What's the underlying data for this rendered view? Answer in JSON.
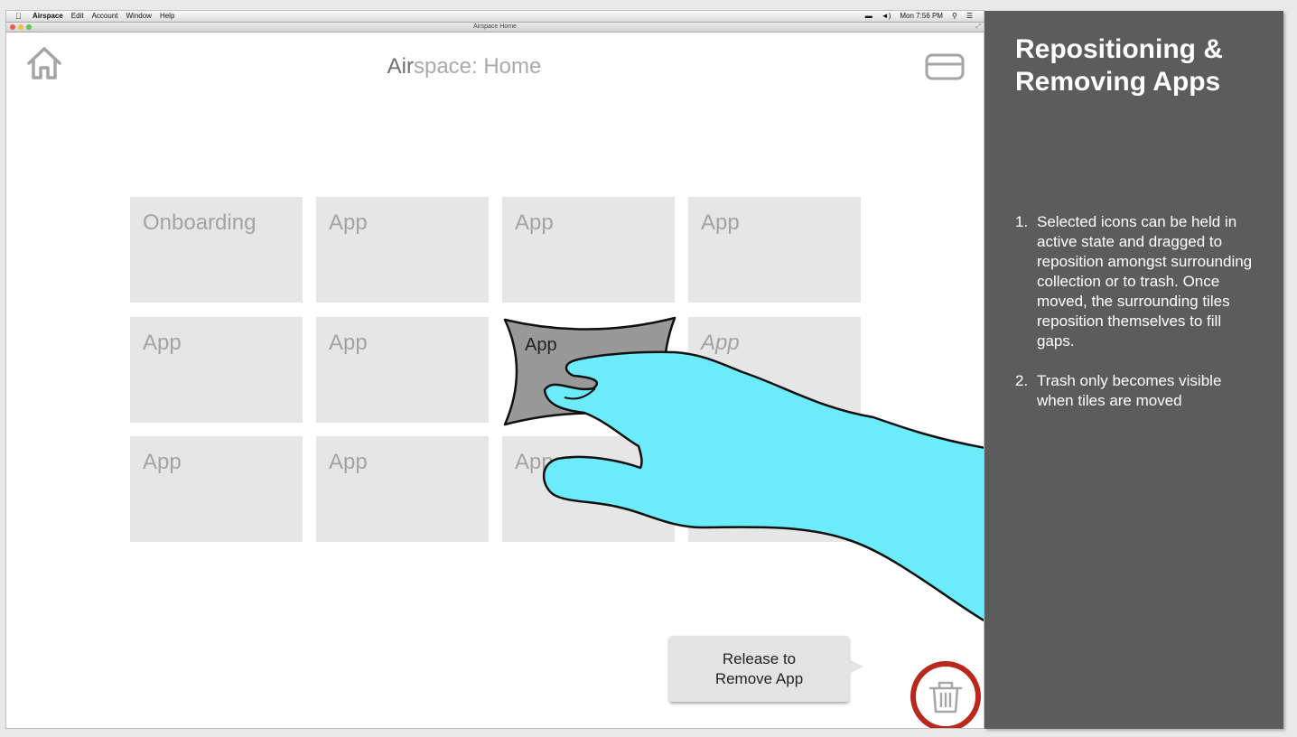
{
  "menu_bar": {
    "app_name": "Airspace",
    "items": [
      "Edit",
      "Account",
      "Window",
      "Help"
    ],
    "clock": "Mon 7:56 PM"
  },
  "window": {
    "title": "Airspace Home"
  },
  "header": {
    "title_strong": "Air",
    "title_rest": "space: Home"
  },
  "tiles": [
    {
      "label": "Onboarding"
    },
    {
      "label": "App"
    },
    {
      "label": "App"
    },
    {
      "label": "App"
    },
    {
      "label": "App"
    },
    {
      "label": "App"
    },
    {
      "label": "App"
    },
    {
      "label": "App"
    },
    {
      "label": "App"
    },
    {
      "label": "App"
    },
    {
      "label": "App"
    },
    {
      "label": "App"
    }
  ],
  "tooltip": {
    "line1": "Release to",
    "line2": "Remove App"
  },
  "annotation": {
    "title": "Repositioning & Removing Apps",
    "notes": [
      {
        "num": "1.",
        "text": "Selected icons can be held in active state and dragged to reposition amongst surrounding collection or to trash. Once moved, the surrounding tiles reposition themselves to fill gaps."
      },
      {
        "num": "2.",
        "text": "Trash only becomes visible when tiles are moved"
      }
    ]
  },
  "colors": {
    "tile": "#e6e6e6",
    "selected_tile": "#999999",
    "hand": "#6cebfb",
    "trash_ring": "#b8281d",
    "panel": "#5c5c5c"
  }
}
